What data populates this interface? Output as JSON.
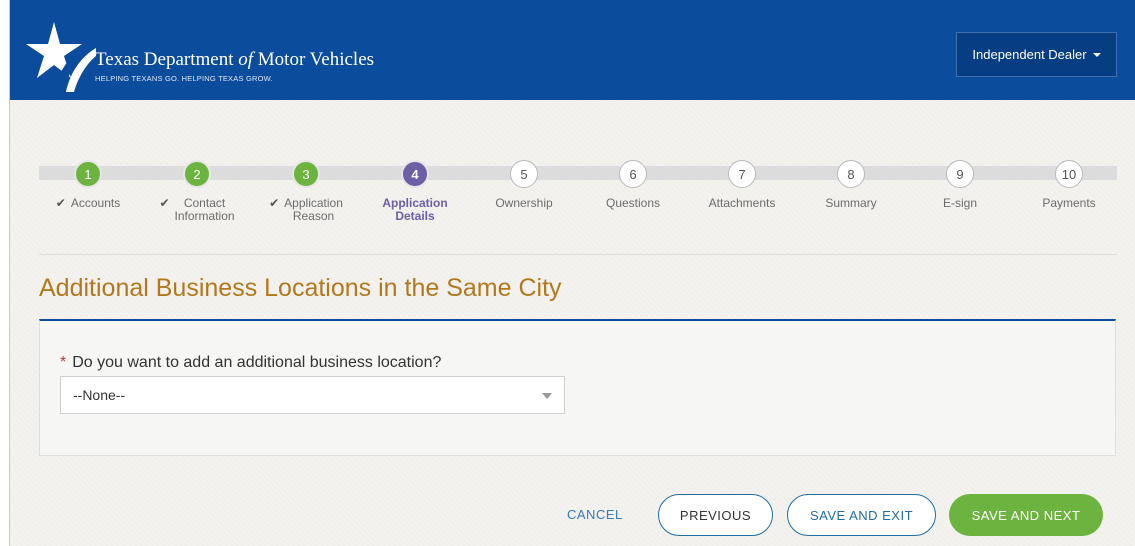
{
  "header": {
    "brand_title_pre": "Texas Department",
    "brand_title_of": "of",
    "brand_title_post": "Motor Vehicles",
    "tagline": "HELPING TEXANS GO. HELPING TEXAS GROW.",
    "user_menu_label": "Independent Dealer",
    "brand_color": "#0c4c9c"
  },
  "progress": {
    "steps": [
      {
        "number": "1",
        "label": "Accounts",
        "label2": "",
        "status": "done"
      },
      {
        "number": "2",
        "label": "Contact",
        "label2": "Information",
        "status": "done"
      },
      {
        "number": "3",
        "label": "Application",
        "label2": "Reason",
        "status": "done"
      },
      {
        "number": "4",
        "label": "Application",
        "label2": "Details",
        "status": "current"
      },
      {
        "number": "5",
        "label": "Ownership",
        "label2": "",
        "status": "todo"
      },
      {
        "number": "6",
        "label": "Questions",
        "label2": "",
        "status": "todo"
      },
      {
        "number": "7",
        "label": "Attachments",
        "label2": "",
        "status": "todo"
      },
      {
        "number": "8",
        "label": "Summary",
        "label2": "",
        "status": "todo"
      },
      {
        "number": "9",
        "label": "E-sign",
        "label2": "",
        "status": "todo"
      },
      {
        "number": "10",
        "label": "Payments",
        "label2": "",
        "status": "todo"
      }
    ],
    "done_color": "#6cb33f",
    "current_color": "#6d5ea6"
  },
  "section": {
    "title": "Additional Business Locations in the Same City"
  },
  "form": {
    "required_mark": "*",
    "question": "Do you want to add an additional business location?",
    "select_value": "--None--"
  },
  "actions": {
    "cancel": "CANCEL",
    "previous": "PREVIOUS",
    "save_exit": "SAVE AND EXIT",
    "save_next": "SAVE AND NEXT"
  }
}
